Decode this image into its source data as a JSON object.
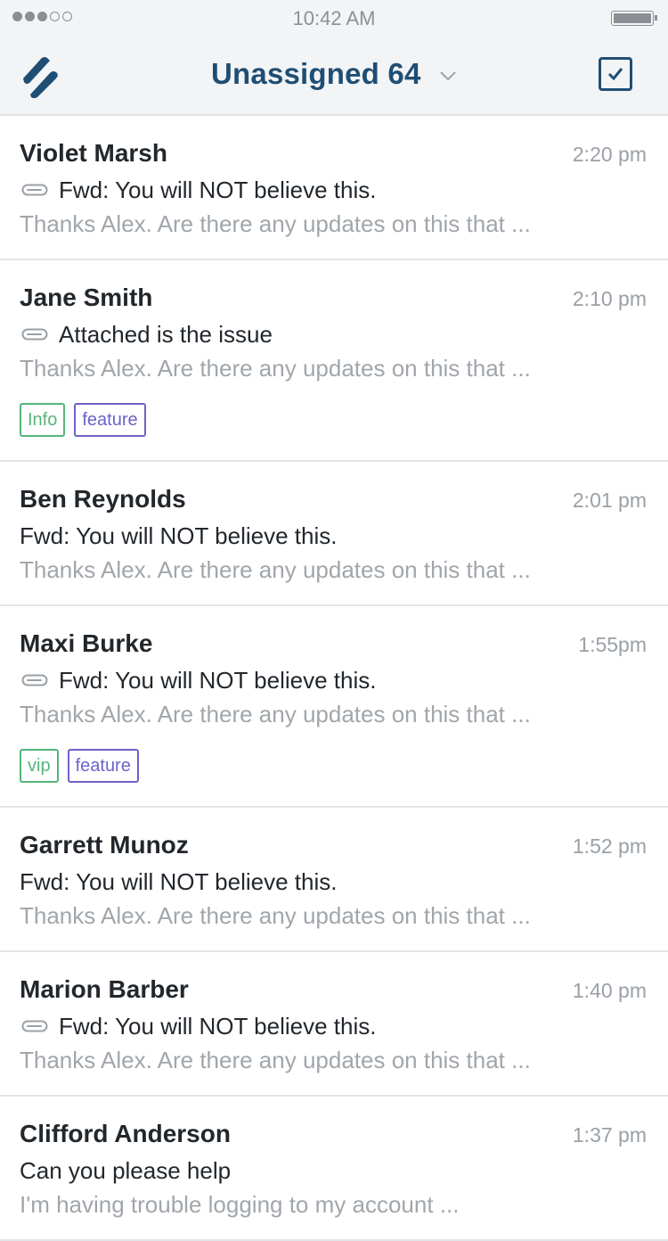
{
  "status_bar": {
    "signal_bars": 5,
    "signal_filled": 3,
    "time": "10:42 AM",
    "battery_level": 1.0
  },
  "header": {
    "logo_icon": "helpscout-logo-icon",
    "title": "Unassigned 64",
    "dropdown_icon": "chevron-down-icon",
    "action_icon": "checkbox-select-icon"
  },
  "colors": {
    "accent": "#1f4e74",
    "tag_green": "#55b57a",
    "tag_purple": "#6c63c8"
  },
  "conversations": [
    {
      "name": "Violet Marsh",
      "time": "2:20 pm",
      "has_attachment": true,
      "subject": "Fwd: You will NOT believe this.",
      "preview": "Thanks Alex. Are there any updates on this that ...",
      "tags": []
    },
    {
      "name": "Jane Smith",
      "time": "2:10 pm",
      "has_attachment": true,
      "subject": "Attached is the issue",
      "preview": "Thanks Alex. Are there any updates on this that ...",
      "tags": [
        {
          "label": "Info",
          "color": "green"
        },
        {
          "label": "feature",
          "color": "purple"
        }
      ]
    },
    {
      "name": "Ben Reynolds",
      "time": "2:01 pm",
      "has_attachment": false,
      "subject": "Fwd: You will NOT believe this.",
      "preview": "Thanks Alex. Are there any updates on this that ...",
      "tags": []
    },
    {
      "name": "Maxi Burke",
      "time": "1:55pm",
      "has_attachment": true,
      "subject": "Fwd: You will NOT believe this.",
      "preview": "Thanks Alex. Are there any updates on this that ...",
      "tags": [
        {
          "label": "vip",
          "color": "green"
        },
        {
          "label": "feature",
          "color": "purple"
        }
      ]
    },
    {
      "name": "Garrett Munoz",
      "time": "1:52 pm",
      "has_attachment": false,
      "subject": "Fwd: You will NOT believe this.",
      "preview": "Thanks Alex. Are there any updates on this that ...",
      "tags": []
    },
    {
      "name": "Marion Barber",
      "time": "1:40 pm",
      "has_attachment": true,
      "subject": "Fwd: You will NOT believe this.",
      "preview": "Thanks Alex. Are there any updates on this that ...",
      "tags": []
    },
    {
      "name": "Clifford Anderson",
      "time": "1:37 pm",
      "has_attachment": false,
      "subject": "Can you please help",
      "preview": "I'm having trouble logging to my account ...",
      "tags": []
    }
  ]
}
